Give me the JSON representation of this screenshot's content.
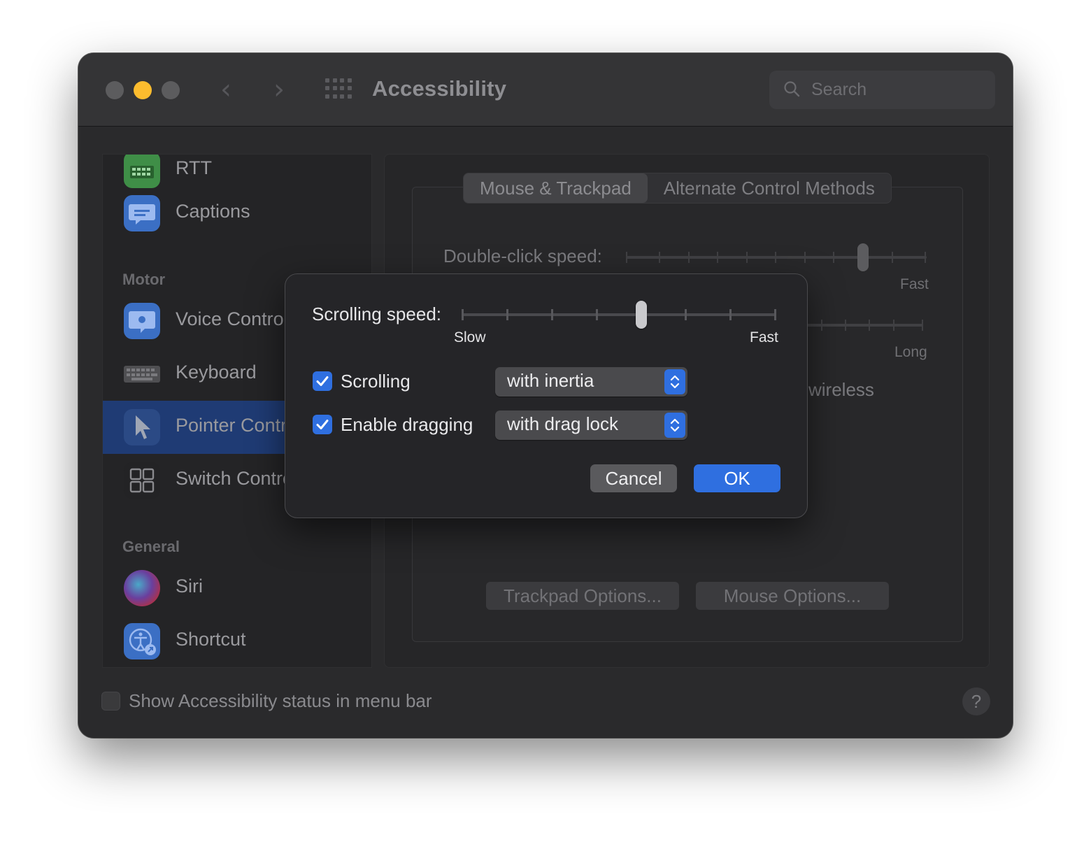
{
  "window": {
    "title": "Accessibility",
    "search_placeholder": "Search"
  },
  "sidebar": {
    "partial_top_label": "RTT",
    "captions_label": "Captions",
    "section_motor": "Motor",
    "section_general": "General",
    "items": [
      {
        "label": "Voice Control",
        "icon": "voice-control-icon"
      },
      {
        "label": "Keyboard",
        "icon": "keyboard-icon"
      },
      {
        "label": "Pointer Control",
        "icon": "pointer-icon",
        "selected": true
      },
      {
        "label": "Switch Control",
        "icon": "switch-control-icon"
      },
      {
        "label": "Siri",
        "icon": "siri-icon"
      },
      {
        "label": "Shortcut",
        "icon": "shortcut-icon"
      }
    ]
  },
  "content": {
    "tabs": [
      "Mouse & Trackpad",
      "Alternate Control Methods"
    ],
    "active_tab": "Mouse & Trackpad",
    "double_click_label": "Double-click speed:",
    "double_click_fast": "Fast",
    "spring_long": "Long",
    "wireless_partial": "wireless",
    "trackpad_options": "Trackpad Options...",
    "mouse_options": "Mouse Options..."
  },
  "footer": {
    "status_label": "Show Accessibility status in menu bar",
    "status_checked": false,
    "help": "?"
  },
  "sheet": {
    "scrolling_speed_label": "Scrolling speed:",
    "slow": "Slow",
    "fast": "Fast",
    "slider_ticks": 8,
    "slider_value_fraction": 0.571,
    "scrolling_label": "Scrolling",
    "scrolling_checked": true,
    "scrolling_option": "with inertia",
    "dragging_label": "Enable dragging",
    "dragging_checked": true,
    "dragging_option": "with drag lock",
    "cancel": "Cancel",
    "ok": "OK"
  },
  "colors": {
    "accent": "#2f6fe0",
    "selection": "#1f3b74",
    "traffic_minimize": "#fcbc2e"
  }
}
